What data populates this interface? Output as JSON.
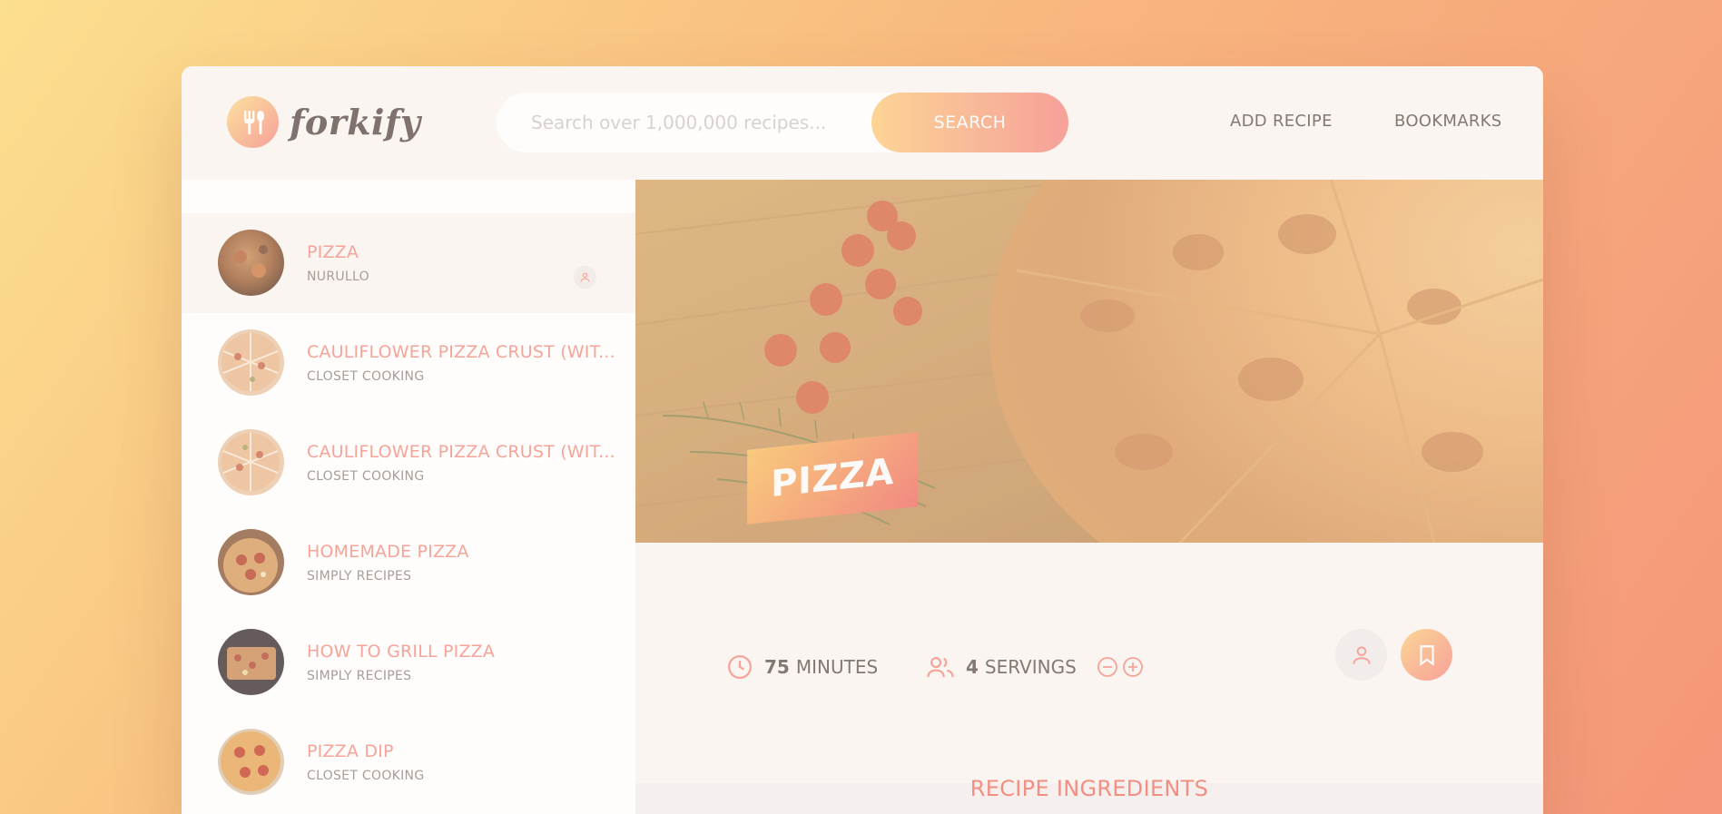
{
  "header": {
    "logo_text": "forkify",
    "search_placeholder": "Search over 1,000,000 recipes...",
    "search_label": "SEARCH",
    "add_recipe_label": "ADD RECIPE",
    "bookmarks_label": "BOOKMARKS"
  },
  "results": [
    {
      "title": "PIZZA",
      "publisher": "NURULLO",
      "user_generated": true,
      "active": true
    },
    {
      "title": "CAULIFLOWER PIZZA CRUST (WIT...",
      "publisher": "CLOSET COOKING",
      "user_generated": false,
      "active": false
    },
    {
      "title": "CAULIFLOWER PIZZA CRUST (WIT...",
      "publisher": "CLOSET COOKING",
      "user_generated": false,
      "active": false
    },
    {
      "title": "HOMEMADE PIZZA",
      "publisher": "SIMPLY RECIPES",
      "user_generated": false,
      "active": false
    },
    {
      "title": "HOW TO GRILL PIZZA",
      "publisher": "SIMPLY RECIPES",
      "user_generated": false,
      "active": false
    },
    {
      "title": "PIZZA DIP",
      "publisher": "CLOSET COOKING",
      "user_generated": false,
      "active": false
    }
  ],
  "recipe": {
    "title": "PIZZA",
    "minutes": "75",
    "minutes_label": "MINUTES",
    "servings": "4",
    "servings_label": "SERVINGS",
    "ingredients_heading": "RECIPE INGREDIENTS"
  },
  "colors": {
    "accent": "#f38e82",
    "gradient_start": "#fbdb89",
    "gradient_end": "#f48982",
    "text_dark": "#615551"
  },
  "icons": {
    "logo": "fork-spoon-icon",
    "time": "clock-icon",
    "servings": "users-icon",
    "decrease": "minus-circle-icon",
    "increase": "plus-circle-icon",
    "user": "user-icon",
    "bookmark": "bookmark-icon"
  }
}
